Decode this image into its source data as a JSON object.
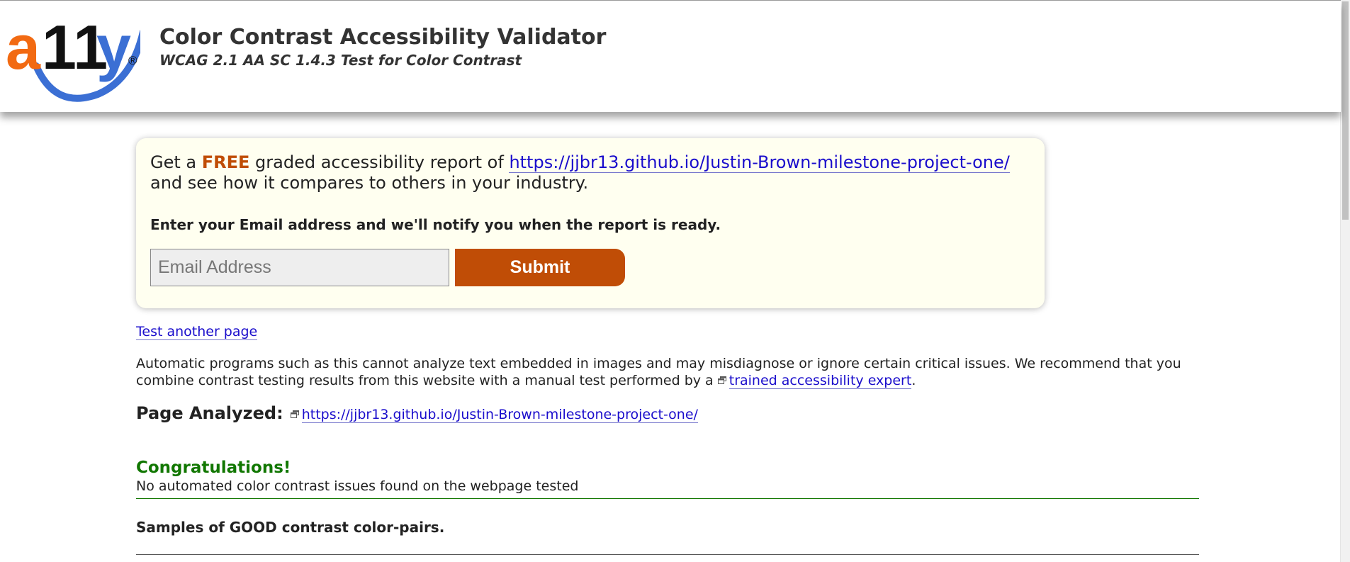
{
  "header": {
    "title": "Color Contrast Accessibility Validator",
    "subtitle": "WCAG 2.1 AA SC 1.4.3 Test for Color Contrast",
    "logo": {
      "text": "a11y",
      "registered_mark": "®"
    }
  },
  "promo": {
    "part1": "Get a ",
    "free": "FREE",
    "part2": " graded accessibility report of ",
    "url": "https://jjbr13.github.io/Justin-Brown-milestone-project-one/",
    "part3": "and see how it compares to others in your industry.",
    "prompt": "Enter your Email address and we'll notify you when the report is ready.",
    "email_placeholder": "Email Address",
    "submit_label": "Submit"
  },
  "links": {
    "test_another": "Test another page"
  },
  "disclaimer": {
    "text": "Automatic programs such as this cannot analyze text embedded in images and may misdiagnose or ignore certain critical issues. We recommend that you combine contrast testing results from this website with a manual test performed by a ",
    "expert_link": "trained accessibility expert",
    "end": "."
  },
  "analysis": {
    "label": "Page Analyzed:",
    "url": "https://jjbr13.github.io/Justin-Brown-milestone-project-one/"
  },
  "result": {
    "heading": "Congratulations!",
    "message": "No automated color contrast issues found on the webpage tested",
    "samples_heading": "Samples of GOOD contrast color-pairs."
  },
  "colors": {
    "brand_orange": "#c04d06",
    "brand_blue": "#3b6fd4",
    "link": "#1a0dcc",
    "success_green": "#117700",
    "promo_bg": "#fffff0"
  }
}
